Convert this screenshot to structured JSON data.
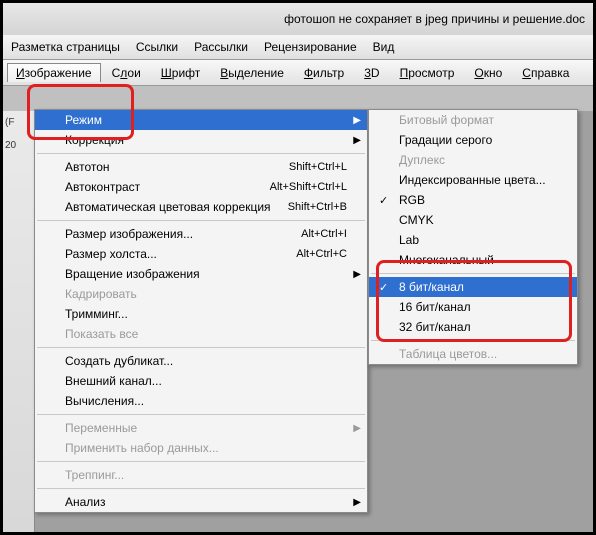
{
  "title": "фотошоп не сохраняет в jpeg причины и решение.doc",
  "topMenu": [
    "Разметка страницы",
    "Ссылки",
    "Рассылки",
    "Рецензирование",
    "Вид"
  ],
  "menubar": [
    {
      "label": "Изображение",
      "active": true,
      "u": 0
    },
    {
      "label": "Слои",
      "u": 1
    },
    {
      "label": "Шрифт",
      "u": 0
    },
    {
      "label": "Выделение",
      "u": 0
    },
    {
      "label": "Фильтр",
      "u": 0
    },
    {
      "label": "3D",
      "u": 0
    },
    {
      "label": "Просмотр",
      "u": 0
    },
    {
      "label": "Окно",
      "u": 0
    },
    {
      "label": "Справка",
      "u": 0
    }
  ],
  "sidebar": {
    "line1": "(F",
    "line2": "20"
  },
  "menu1": {
    "groups": [
      [
        {
          "label": "Режим",
          "submenu": true,
          "selected": true
        },
        {
          "label": "Коррекция",
          "submenu": true
        }
      ],
      [
        {
          "label": "Автотон",
          "shortcut": "Shift+Ctrl+L"
        },
        {
          "label": "Автоконтраст",
          "shortcut": "Alt+Shift+Ctrl+L"
        },
        {
          "label": "Автоматическая цветовая коррекция",
          "shortcut": "Shift+Ctrl+B"
        }
      ],
      [
        {
          "label": "Размер изображения...",
          "shortcut": "Alt+Ctrl+I"
        },
        {
          "label": "Размер холста...",
          "shortcut": "Alt+Ctrl+C"
        },
        {
          "label": "Вращение изображения",
          "submenu": true
        },
        {
          "label": "Кадрировать",
          "disabled": true
        },
        {
          "label": "Тримминг..."
        },
        {
          "label": "Показать все",
          "disabled": true
        }
      ],
      [
        {
          "label": "Создать дубликат..."
        },
        {
          "label": "Внешний канал..."
        },
        {
          "label": "Вычисления..."
        }
      ],
      [
        {
          "label": "Переменные",
          "submenu": true,
          "disabled": true
        },
        {
          "label": "Применить набор данных...",
          "disabled": true
        }
      ],
      [
        {
          "label": "Треппинг...",
          "disabled": true
        }
      ],
      [
        {
          "label": "Анализ",
          "submenu": true
        }
      ]
    ]
  },
  "menu2": {
    "groups": [
      [
        {
          "label": "Битовый формат",
          "disabled": true
        },
        {
          "label": "Градации серого"
        },
        {
          "label": "Дуплекс",
          "disabled": true
        },
        {
          "label": "Индексированные цвета..."
        },
        {
          "label": "RGB",
          "checked": true
        },
        {
          "label": "CMYK"
        },
        {
          "label": "Lab"
        },
        {
          "label": "Многоканальный"
        }
      ],
      [
        {
          "label": "8 бит/канал",
          "checked": true,
          "selected": true
        },
        {
          "label": "16 бит/канал"
        },
        {
          "label": "32 бит/канал"
        }
      ],
      [
        {
          "label": "Таблица цветов...",
          "disabled": true
        }
      ]
    ]
  }
}
